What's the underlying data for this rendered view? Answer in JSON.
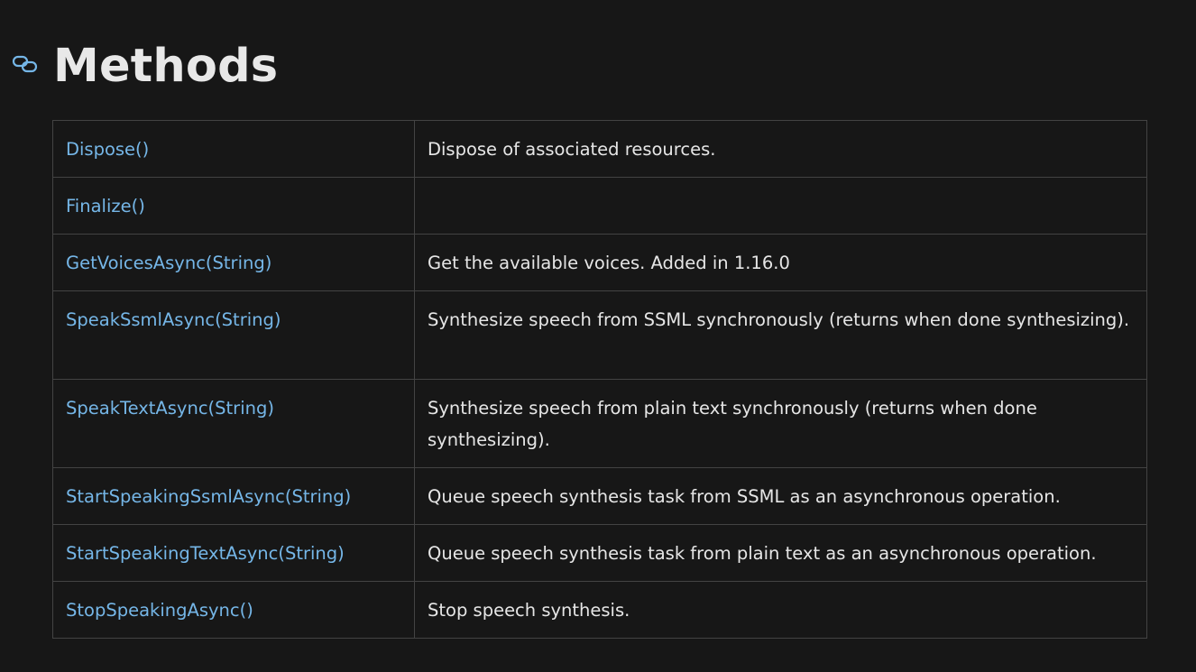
{
  "colors": {
    "background": "#171717",
    "text": "#e6e6e6",
    "link": "#75b6e7",
    "border": "#434343",
    "anchor_icon": "#75b6e7"
  },
  "heading": {
    "anchor_icon": "link-icon",
    "title": "Methods"
  },
  "methods": [
    {
      "name": "Dispose()",
      "description": "Dispose of associated resources."
    },
    {
      "name": "Finalize()",
      "description": ""
    },
    {
      "name": "GetVoicesAsync(String)",
      "description": "Get the available voices. Added in 1.16.0"
    },
    {
      "name": "SpeakSsmlAsync(String)",
      "description": "Synthesize speech from SSML synchronously (returns when done synthesizing)."
    },
    {
      "name": "SpeakTextAsync(String)",
      "description": "Synthesize speech from plain text synchronously (returns when done synthesizing)."
    },
    {
      "name": "StartSpeakingSsmlAsync(String)",
      "description": "Queue speech synthesis task from SSML as an asynchronous operation."
    },
    {
      "name": "StartSpeakingTextAsync(String)",
      "description": "Queue speech synthesis task from plain text as an asynchronous operation."
    },
    {
      "name": "StopSpeakingAsync()",
      "description": "Stop speech synthesis."
    }
  ]
}
